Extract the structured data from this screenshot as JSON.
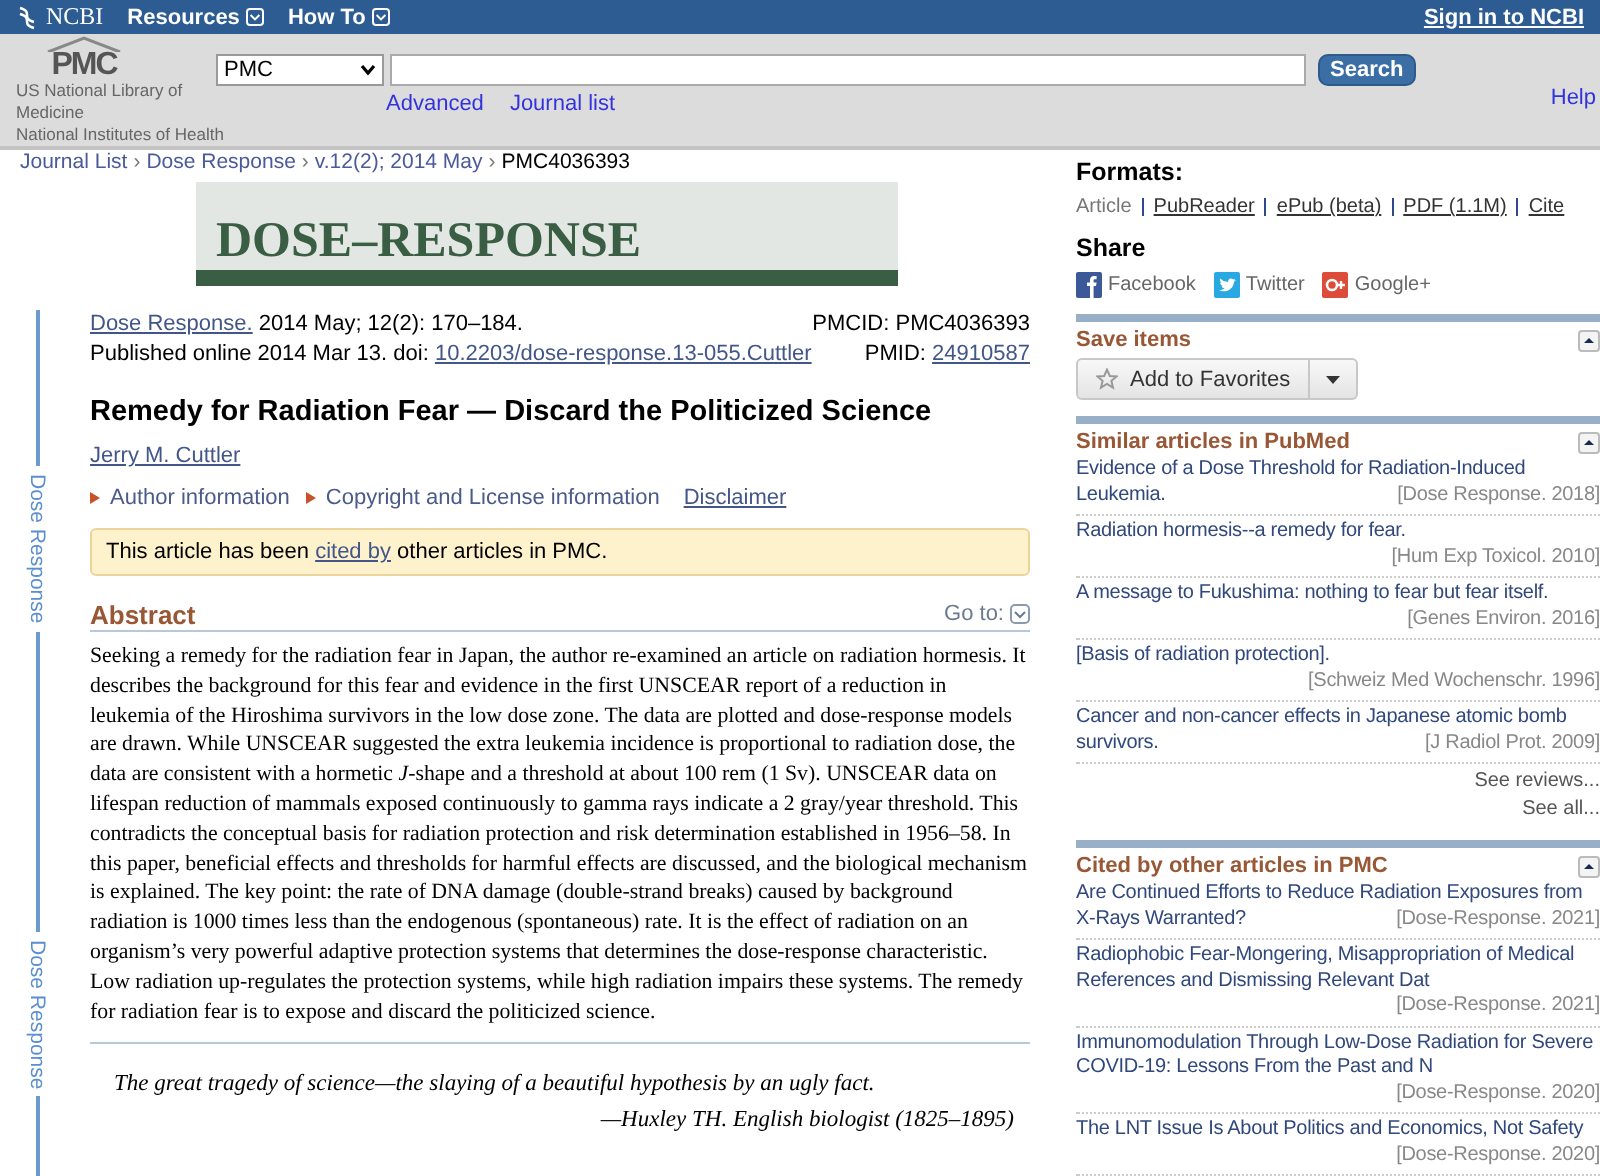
{
  "topbar": {
    "logo": "NCBI",
    "menus": [
      "Resources",
      "How To"
    ],
    "sign_in": "Sign in to NCBI"
  },
  "header": {
    "logo": "PMC",
    "logo_lines": [
      "US National Library of",
      "Medicine",
      "National Institutes of Health"
    ],
    "database": "PMC",
    "search_button": "Search",
    "links": [
      "Advanced",
      "Journal list"
    ],
    "help": "Help"
  },
  "breadcrumb": {
    "separator": "›",
    "items": [
      {
        "label": "Journal List",
        "kind": "link"
      },
      {
        "label": "Dose Response",
        "kind": "link"
      },
      {
        "label": "v.12(2); 2014 May",
        "kind": "link"
      },
      {
        "label": "PMC4036393",
        "kind": "current"
      }
    ]
  },
  "side_labels": [
    "Dose Response",
    "Dose Response"
  ],
  "journal_banner": "DOSE–RESPONSE",
  "citation": {
    "journal": "Dose Response.",
    "issue": "2014 May; 12(2): 170–184.",
    "published": "Published online 2014 Mar 13. doi:",
    "doi": "10.2203/dose-response.13-055.Cuttler",
    "pmcid": "PMCID: PMC4036393",
    "pmid_label": "PMID:",
    "pmid": "24910587"
  },
  "title": "Remedy for Radiation Fear — Discard the Politicized Science",
  "author": "Jerry M. Cuttler",
  "info_links": [
    {
      "label": "Author information",
      "kind": "expander"
    },
    {
      "label": "Copyright and License information",
      "kind": "expander"
    },
    {
      "label": "Disclaimer",
      "kind": "link"
    }
  ],
  "notice": {
    "before": "This article has been",
    "link": "cited by",
    "after": "other articles in PMC."
  },
  "abstract": {
    "heading": "Abstract",
    "goto": "Go to:",
    "text": "Seeking a remedy for the radiation fear in Japan, the author re-examined an article on radiation hormesis. It describes the background for this fear and evidence in the first UNSCEAR report of a reduction in leukemia of the Hiroshima survivors in the low dose zone. The data are plotted and dose-response models are drawn. While UNSCEAR suggested the extra leukemia incidence is proportional to radiation dose, the data are consistent with a hormetic *J*-shape and a threshold at about 100 rem (1 Sv). UNSCEAR data on lifespan reduction of mammals exposed continuously to gamma rays indicate a 2 gray/year threshold. This contradicts the conceptual basis for radiation protection and risk determination established in 1956–58. In this paper, beneficial effects and thresholds for harmful effects are discussed, and the biological mechanism is explained. The key point: the rate of DNA damage (double-strand breaks) caused by background radiation is 1000 times less than the endogenous (spontaneous) rate. It is the effect of radiation on an organism’s very powerful adaptive protection systems that determines the dose-response characteristic. Low radiation up-regulates the protection systems, while high radiation impairs these systems. The remedy for radiation fear is to expose and discard the politicized science."
  },
  "epigraph": {
    "quote": "The great tragedy of science—the slaying of a beautiful hypothesis by an ugly fact.",
    "attribution": "—Huxley TH. English biologist (1825–1895)"
  },
  "formats": {
    "heading": "Formats:",
    "items": [
      {
        "label": "Article",
        "selected": true
      },
      {
        "label": "PubReader",
        "selected": false
      },
      {
        "label": "ePub (beta)",
        "selected": false
      },
      {
        "label": "PDF (1.1M)",
        "selected": false
      },
      {
        "label": "Cite",
        "selected": false
      }
    ]
  },
  "share": {
    "heading": "Share",
    "items": [
      {
        "label": "Facebook",
        "kind": "facebook"
      },
      {
        "label": "Twitter",
        "kind": "twitter"
      },
      {
        "label": "Google+",
        "kind": "google"
      }
    ]
  },
  "save_items": {
    "heading": "Save items",
    "button": "Add to Favorites"
  },
  "similar": {
    "heading": "Similar articles in PubMed",
    "items": [
      {
        "title": "Evidence of a Dose Threshold for Radiation-Induced Leukemia.",
        "source": "[Dose Response. 2018]"
      },
      {
        "title": "Radiation hormesis--a remedy for fear.",
        "source": "[Hum Exp Toxicol. 2010]"
      },
      {
        "title": "A message to Fukushima: nothing to fear but fear itself.",
        "source": "[Genes Environ. 2016]"
      },
      {
        "title": "[Basis of radiation protection].",
        "source": "[Schweiz Med Wochenschr. 1996]"
      },
      {
        "title": "Cancer and non-cancer effects in Japanese atomic bomb survivors.",
        "source": "[J Radiol Prot. 2009]"
      }
    ],
    "more_links": [
      "See reviews...",
      "See all..."
    ]
  },
  "cited_by": {
    "heading": "Cited by other articles in PMC",
    "items": [
      {
        "title": "Are Continued Efforts to Reduce Radiation Exposures from X-Rays Warranted?",
        "source": "[Dose-Response. 2021]"
      },
      {
        "title": "Radiophobic Fear-Mongering, Misappropriation of Medical References and Dismissing Relevant Dat",
        "source": "[Dose-Response. 2021]"
      },
      {
        "title": "Immunomodulation Through Low-Dose Radiation for Severe COVID-19: Lessons From the Past and N",
        "source": "[Dose-Response. 2020]"
      },
      {
        "title": "The LNT Issue Is About Politics and Economics, Not Safety",
        "source": "[Dose-Response. 2020]"
      }
    ]
  }
}
